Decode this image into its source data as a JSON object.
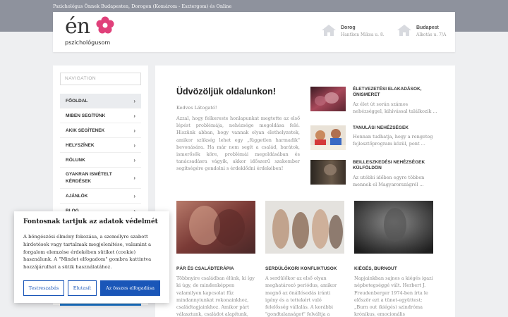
{
  "topbar": {
    "text": "Pszichológus Önnek Budapesten, Dorogon (Komárom - Esztergom) és Online"
  },
  "logo": {
    "main": "én",
    "sub": "pszichológusom"
  },
  "locations": [
    {
      "city": "Dorog",
      "address": "Hantken Miksa u. 8."
    },
    {
      "city": "Budapest",
      "address": "Alkotás u. 7/A"
    }
  ],
  "sidebar": {
    "placeholder": "NAVIGATION",
    "items": [
      {
        "label": "FŐOLDAL"
      },
      {
        "label": "MIBEN SEGÍTÜNK"
      },
      {
        "label": "AKIK SEGÍTENEK"
      },
      {
        "label": "HELYSZÍNEK"
      },
      {
        "label": "RÓLUNK"
      },
      {
        "label": "GYAKRAN ISMÉTELT KÉRDÉSEK"
      },
      {
        "label": "AJÁNLÓK"
      },
      {
        "label": "BLOG"
      }
    ]
  },
  "main": {
    "title": "Üdvözöljük oldalunkon!",
    "greeting": "Kedves Látogató!",
    "intro": "Azzal, hogy felkereste honlapunkat megtette az első lépést problémája, nehézsége megoldása felé. Hiszünk abban, hogy vannak olyan élethelyzetek, amikor szükség lehet egy „független harmadik\" bevonására. Ha már nem segít a család, barátok, ismerősök köre, problémái megoldásában és tanácsadásra vágyik, akkor időszerű szakember segítségére gondolni s érdeklődni érdekében!",
    "articles": [
      {
        "title": "ÉLETVEZETÉSI ELAKADÁSOK, ÖNISMERET",
        "text": "Az élet út során számos nehézséggel, kihívással találkozik ..."
      },
      {
        "title": "TANULÁSI NEHÉZSÉGEK",
        "text": "Honnan tudhatja, hogy a rengeteg fejlesztőprogram közül, pont ..."
      },
      {
        "title": "BEILLESZKEDÉSI NEHÉZSÉGEK KÜLFÖLDÖN",
        "text": "Az utóbbi időben egyre többen mennek el Magyarországról ..."
      }
    ],
    "cards": [
      {
        "title": "PÁR ÉS CSALÁDTERÁPIA",
        "text": "Többnyire családban élünk, ki így ki úgy, de mindenképpen valamilyen kapcsolat fűz mindannyiunkat rokonainkhoz, családtagjainkhoz. Amikor párt választunk, családot alapítunk,"
      },
      {
        "title": "SERDÜLŐKORI KONFLIKTUSOK",
        "text": "A serdülőkor az első olyan meghatározó periódus, amikor megnő az önállósodás iránti igény és a tettekért való felelősség vállalás. A korábbi \"gondtalanságot\" felváltja a felnőtt"
      },
      {
        "title": "KIÉGÉS, BURNOUT",
        "text": "Napjainkban sajnos a kiégés igazi népbetegséggé vált. Herbert J. Freudenberger 1974-ben írta le először ezt a tünet-együttest; „Burn out (kiégés) szindróma krónikus, emocionális megterhelések,"
      }
    ]
  },
  "cookie": {
    "title": "Fontosnak tartjuk az adatok védelmét",
    "text": "A böngészési élmény fokozása, a személyre szabott hirdetések vagy tartalmak megjelenítése, valamint a forgalom elemzése érdekében sütiket (cookie) használunk. A \"Mindet elfogadom\" gombra kattintva hozzájárulhat a sütik használatához.",
    "btn_settings": "Testreszabás",
    "btn_reject": "Elutasít",
    "btn_accept": "Az összes elfogadása"
  },
  "colors": {
    "accent": "#1a56b8",
    "logo_flower": "#e0407a",
    "topbar": "#8e929d"
  }
}
